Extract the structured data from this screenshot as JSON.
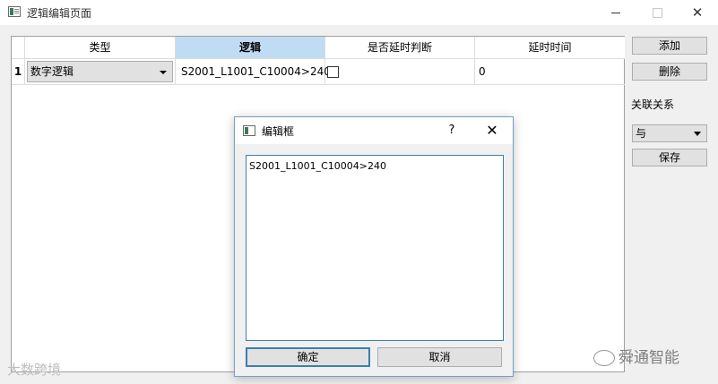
{
  "window": {
    "title": "逻辑编辑页面"
  },
  "table": {
    "headers": [
      "类型",
      "逻辑",
      "是否延时判断",
      "延时时间"
    ],
    "rows": [
      {
        "index": "1",
        "type": "数字逻辑",
        "logic": "S2001_L1001_C10004>240",
        "delay_check": false,
        "delay_time": "0"
      }
    ]
  },
  "side": {
    "add_label": "添加",
    "delete_label": "删除",
    "relation_label": "关联关系",
    "relation_value": "与",
    "save_label": "保存"
  },
  "dialog": {
    "title": "编辑框",
    "help": "?",
    "close": "✕",
    "text": "S2001_L1001_C10004>240",
    "ok_label": "确定",
    "cancel_label": "取消"
  },
  "watermarks": {
    "left": "大数跨境",
    "right": "舜通智能"
  }
}
